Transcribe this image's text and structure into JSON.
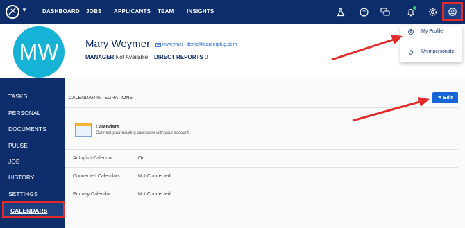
{
  "nav": {
    "links": [
      "DASHBOARD",
      "JOBS",
      "APPLICANTS",
      "TEAM",
      "INSIGHTS"
    ]
  },
  "profile": {
    "initials": "MW",
    "name": "Mary Weymer",
    "email": "mweymer+demo@careerplug.com",
    "manager_label": "MANAGER",
    "manager_value": "Not Available",
    "reports_label": "DIRECT REPORTS",
    "reports_value": "0"
  },
  "dropdown": {
    "my_profile": "My Profile",
    "unimpersonate": "Unimpersonate"
  },
  "sidebar": {
    "items": [
      "TASKS",
      "PERSONAL",
      "DOCUMENTS",
      "PULSE",
      "JOB",
      "HISTORY",
      "SETTINGS"
    ],
    "active": "CALENDARS"
  },
  "content": {
    "section_title": "CALENDAR INTEGRATIONS",
    "edit_label": "Edit",
    "calendars_title": "Calendars",
    "calendars_sub": "Connect your existing calendars with your account.",
    "rows": [
      {
        "label": "Autopilot Calendar",
        "value": "On"
      },
      {
        "label": "Connected Calendars",
        "value": "Not Connected"
      },
      {
        "label": "Primary Calendar",
        "value": "Not Connected"
      }
    ]
  },
  "colors": {
    "nav_bg": "#0d2d6b",
    "avatar_bg": "#17b3d6",
    "accent": "#1565d8",
    "highlight": "#e32b2b"
  }
}
